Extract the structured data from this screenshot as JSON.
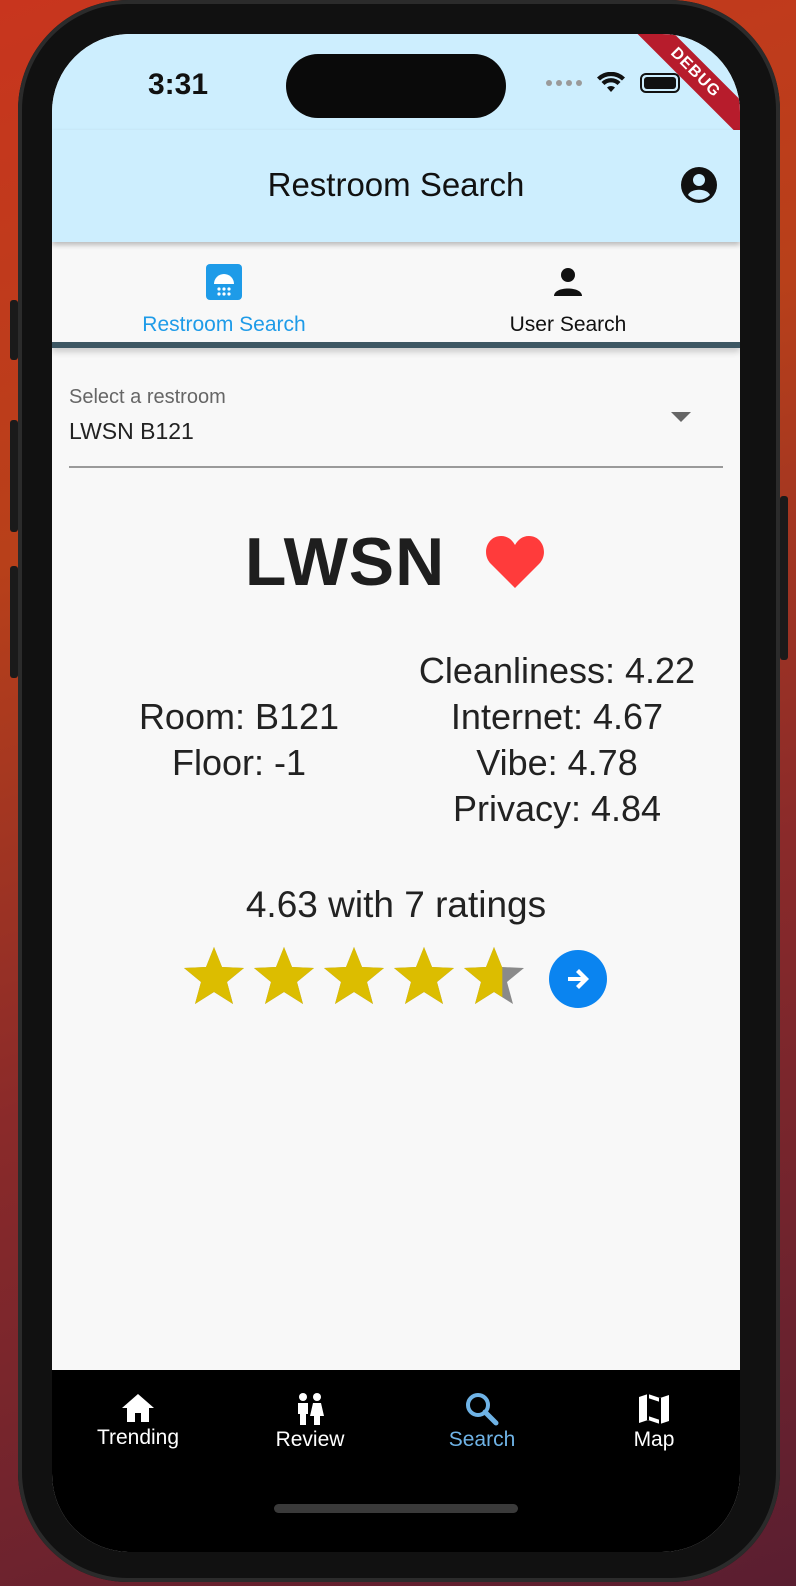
{
  "status_bar": {
    "time": "3:31",
    "debug_banner": "DEBUG"
  },
  "app_bar": {
    "title": "Restroom Search"
  },
  "tabs": [
    {
      "label": "Restroom Search",
      "active": true
    },
    {
      "label": "User Search",
      "active": false
    }
  ],
  "dropdown": {
    "label": "Select a restroom",
    "value": "LWSN B121"
  },
  "restroom": {
    "building": "LWSN",
    "room": "Room: B121",
    "floor": "Floor: -1",
    "cleanliness": "Cleanliness: 4.22",
    "internet": "Internet: 4.67",
    "vibe": "Vibe: 4.78",
    "privacy": "Privacy: 4.84",
    "summary": "4.63 with 7 ratings",
    "star_rating": 4.63,
    "star_max": 5,
    "favorited": true
  },
  "bottom_nav": [
    {
      "label": "Trending",
      "icon": "home-icon",
      "active": false
    },
    {
      "label": "Review",
      "icon": "people-icon",
      "active": false
    },
    {
      "label": "Search",
      "icon": "search-icon",
      "active": true
    },
    {
      "label": "Map",
      "icon": "map-icon",
      "active": false
    }
  ],
  "colors": {
    "accent": "#1e9be8",
    "star": "#dcbd00",
    "heart": "#ff3b3b",
    "header": "#cdeefe"
  }
}
